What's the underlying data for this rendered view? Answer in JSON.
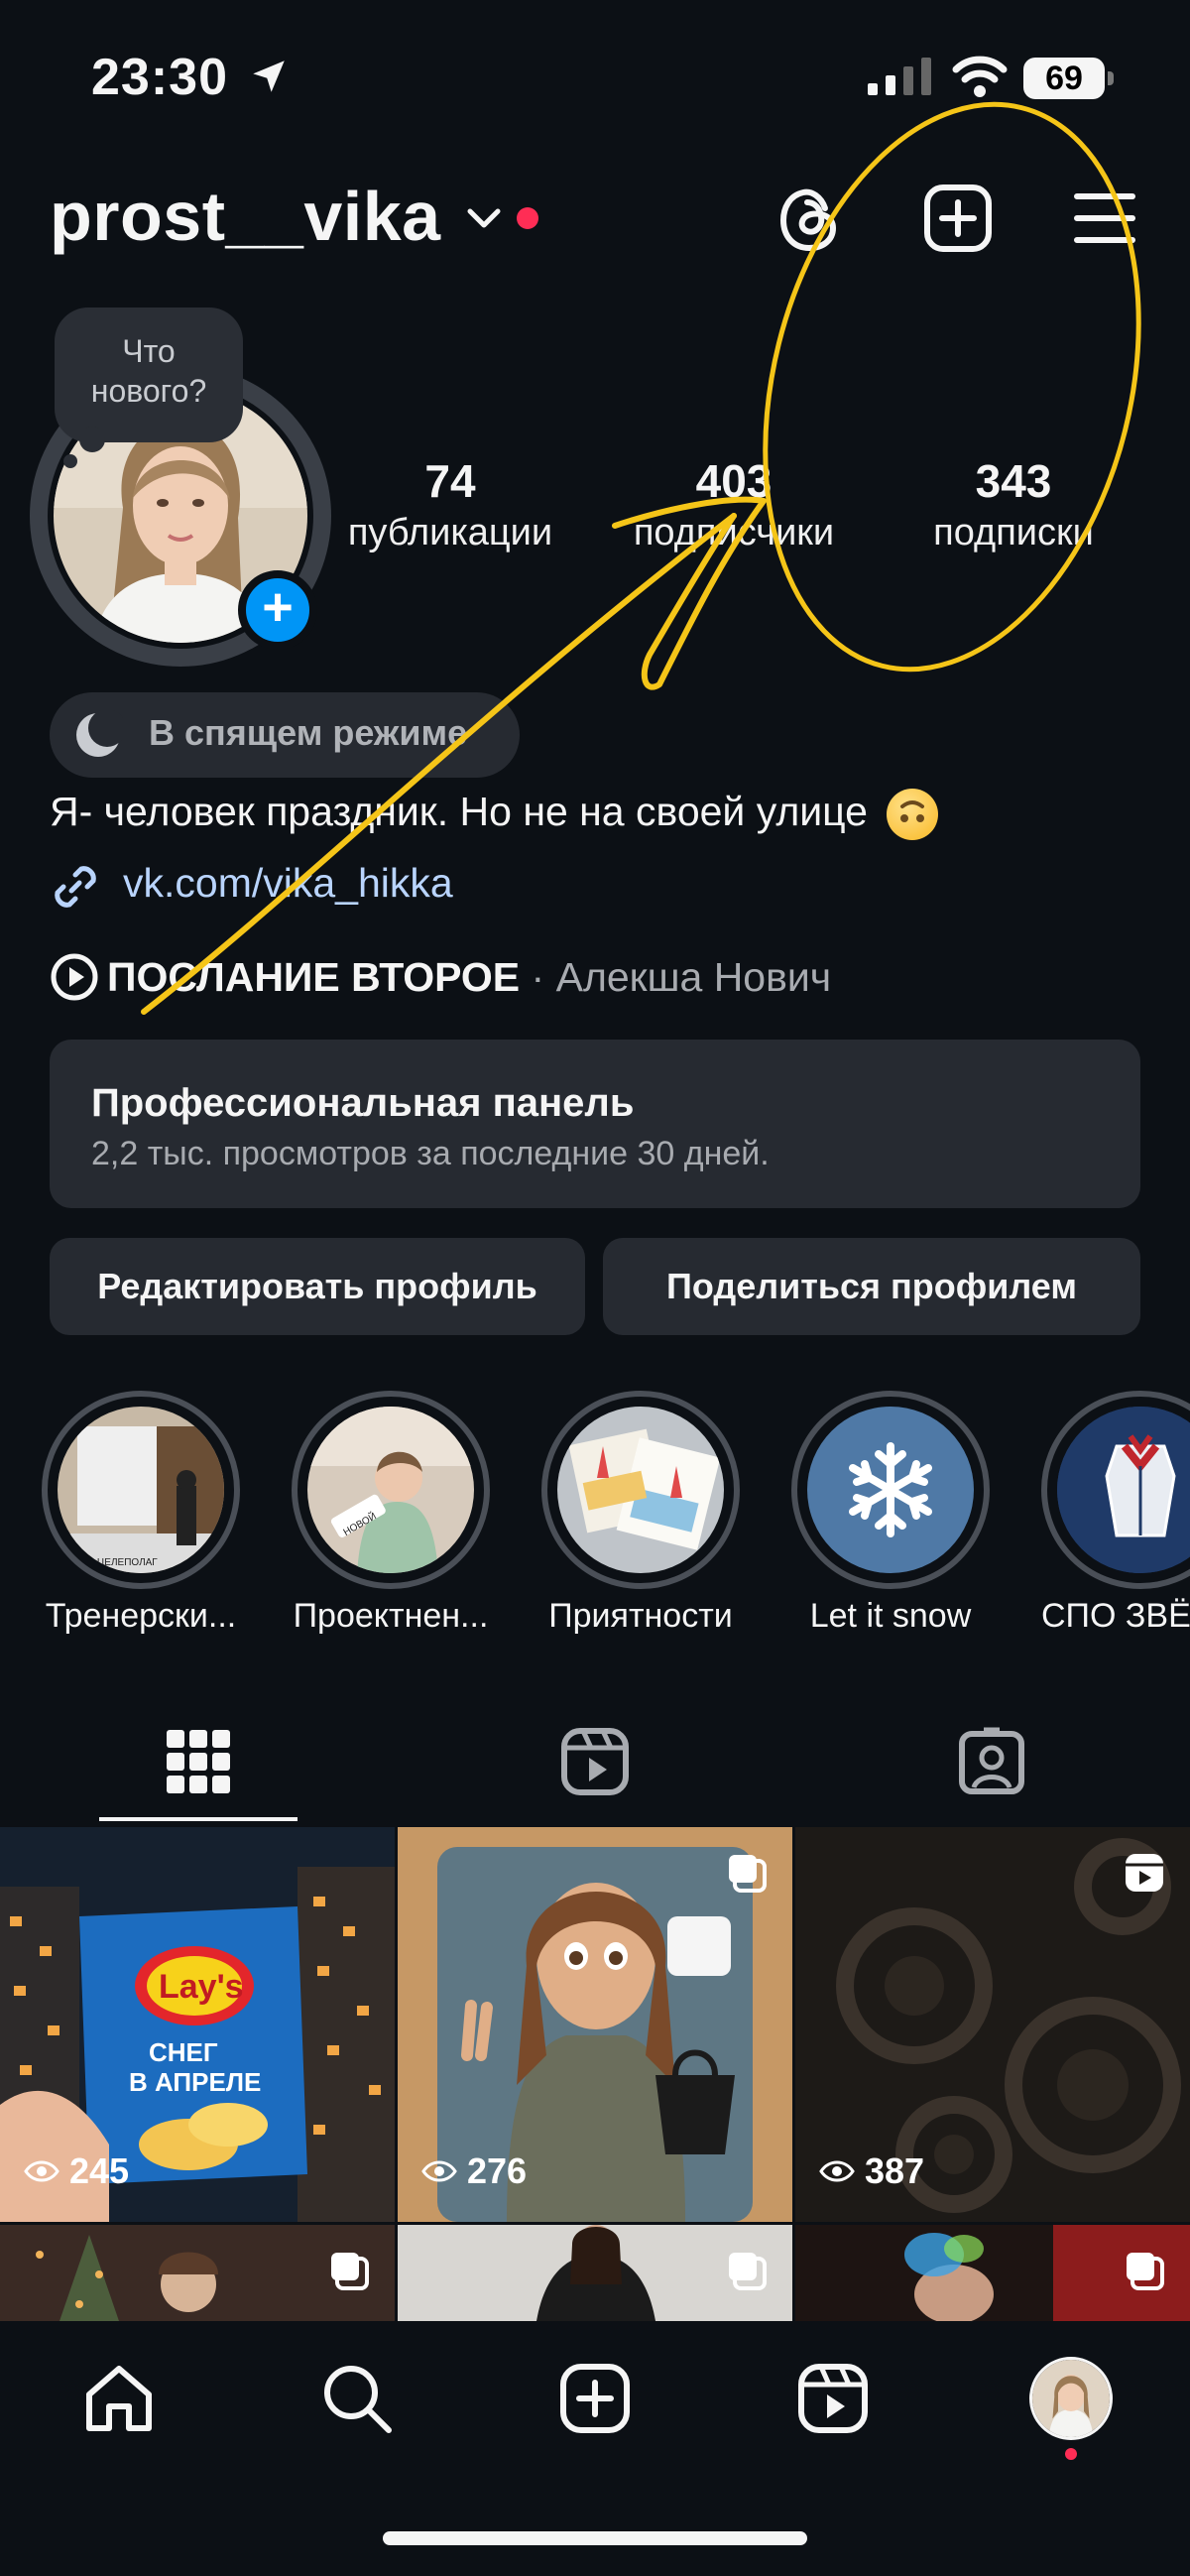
{
  "status_bar": {
    "time": "23:30",
    "battery": "69"
  },
  "header": {
    "username": "prost__vika"
  },
  "note": {
    "text_line1": "Что",
    "text_line2": "нового?"
  },
  "stats": [
    {
      "value": "74",
      "label": "публикации"
    },
    {
      "value": "403",
      "label": "подписчики"
    },
    {
      "value": "343",
      "label": "подписки"
    }
  ],
  "status_pill": {
    "label": "В спящем режиме"
  },
  "bio": {
    "text": "Я- человек праздник. Но не на своей улице"
  },
  "link": {
    "text": "vk.com/vika_hikka"
  },
  "music": {
    "title": "ПОСЛАНИЕ ВТОРОЕ",
    "separator": " · ",
    "artist": "Алекша Нович"
  },
  "pro_panel": {
    "title": "Профессиональная панель",
    "subtitle": "2,2 тыс. просмотров за последние 30 дней."
  },
  "buttons": {
    "edit": "Редактировать профиль",
    "share": "Поделиться профилем"
  },
  "highlights": [
    {
      "label": "Тренерски..."
    },
    {
      "label": "Проектнен..."
    },
    {
      "label": "Приятности"
    },
    {
      "label": "Let it snow"
    },
    {
      "label": "СПО ЗВЁ"
    }
  ],
  "highlight_text": {
    "hl1_banner": "БУРЯ. ЦЕЛЕПОЛАГ",
    "hl2_sign": "НОВОЙ"
  },
  "posts": [
    {
      "views": "245",
      "type": "photo",
      "pack_brand": "Lay's",
      "pack_text_line1": "СНЕГ",
      "pack_text_line2": "В АПРЕЛЕ"
    },
    {
      "views": "276",
      "type": "carousel"
    },
    {
      "views": "387",
      "type": "reel"
    },
    {
      "type": "carousel"
    },
    {
      "type": "carousel"
    },
    {
      "type": "carousel"
    }
  ],
  "colors": {
    "background": "#0c1015",
    "accent": "#0095f6",
    "link": "#b9d4fd",
    "doodle": "#f5c518",
    "notification": "#ff2d55"
  }
}
